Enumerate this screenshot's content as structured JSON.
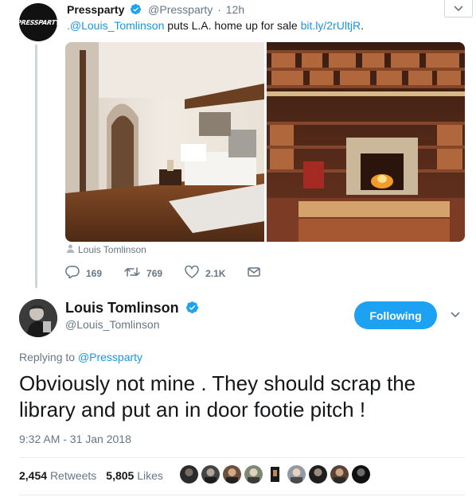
{
  "parent_tweet": {
    "name": "Pressparty",
    "handle": "@Pressparty",
    "time": "12h",
    "avatar_text": "PRESSPARTY",
    "mention": ".@Louis_Tomlinson",
    "text": " puts L.A. home up for sale ",
    "link": "bit.ly/2rUltjR",
    "end": ".",
    "tagged": "Louis Tomlinson",
    "replies": "169",
    "retweets": "769",
    "likes": "2.1K"
  },
  "main_tweet": {
    "name": "Louis Tomlinson",
    "handle": "@Louis_Tomlinson",
    "follow_label": "Following",
    "replying_label": "Replying to ",
    "replying_to": "@Pressparty",
    "text": "Obviously not mine . They should scrap the library and put an in door footie pitch !",
    "timestamp": "9:32 AM - 31 Jan 2018",
    "retweet_count": "2,454",
    "retweet_label": "Retweets",
    "like_count": "5,805",
    "like_label": "Likes"
  },
  "colors": {
    "accent": "#1da1f2",
    "link": "#1b95e0",
    "muted": "#657786",
    "text": "#14171a"
  },
  "icons": [
    "verified-badge-icon",
    "chevron-down-icon",
    "reply-icon",
    "retweet-icon",
    "heart-icon",
    "direct-message-icon",
    "person-icon"
  ]
}
